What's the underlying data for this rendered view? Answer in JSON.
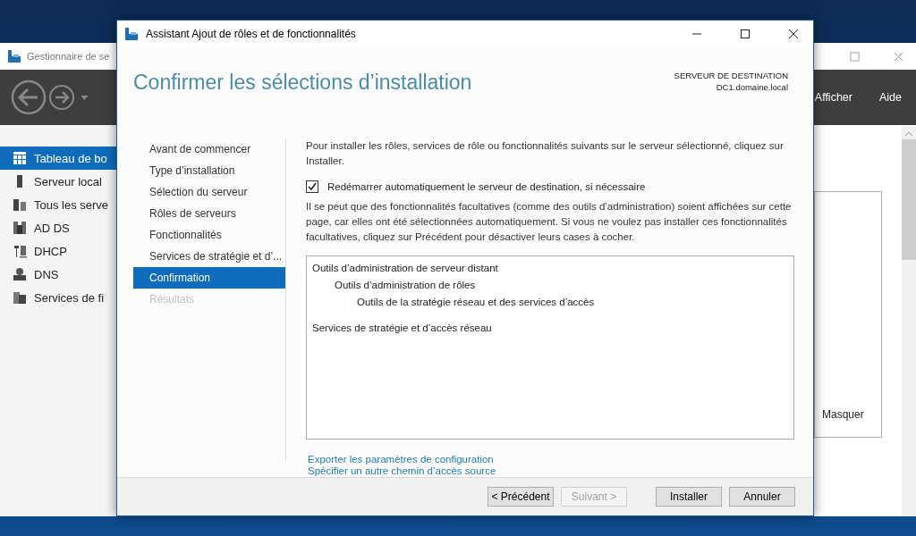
{
  "background_window": {
    "title": "Gestionnaire de se",
    "menu": [
      "Afficher",
      "Aide"
    ],
    "sidebar": [
      {
        "label": "Tableau de bo",
        "kind": "dashboard",
        "selected": true
      },
      {
        "label": "Serveur local",
        "kind": "server",
        "selected": false
      },
      {
        "label": "Tous les serve",
        "kind": "servers",
        "selected": false
      },
      {
        "label": "AD DS",
        "kind": "adds",
        "selected": false
      },
      {
        "label": "DHCP",
        "kind": "dhcp",
        "selected": false
      },
      {
        "label": "DNS",
        "kind": "dns",
        "selected": false
      },
      {
        "label": "Services de fi",
        "kind": "files",
        "selected": false
      }
    ],
    "panel_link": "Masquer"
  },
  "dialog": {
    "title": "Assistant Ajout de rôles et de fonctionnalités",
    "heading": "Confirmer les sélections d’installation",
    "destination_label": "SERVEUR DE DESTINATION",
    "destination_server": "DC1.domaine.local",
    "steps": [
      {
        "label": "Avant de commencer",
        "selected": false,
        "disabled": false
      },
      {
        "label": "Type d’installation",
        "selected": false,
        "disabled": false
      },
      {
        "label": "Sélection du serveur",
        "selected": false,
        "disabled": false
      },
      {
        "label": "Rôles de serveurs",
        "selected": false,
        "disabled": false
      },
      {
        "label": "Fonctionnalités",
        "selected": false,
        "disabled": false
      },
      {
        "label": "Services de stratégie et d’...",
        "selected": false,
        "disabled": false
      },
      {
        "label": "Confirmation",
        "selected": true,
        "disabled": false
      },
      {
        "label": "Résultats",
        "selected": false,
        "disabled": true
      }
    ],
    "intro": "Pour installer les rôles, services de rôle ou fonctionnalités suivants sur le serveur sélectionné, cliquez sur Installer.",
    "restart_option": {
      "label": "Redémarrer automatiquement le serveur de destination, si nécessaire",
      "checked": true
    },
    "note": "Il se peut que des fonctionnalités facultatives (comme des outils d’administration) soient affichées sur cette page, car elles ont été sélectionnées automatiquement. Si vous ne voulez pas installer ces fonctionnalités facultatives, cliquez sur Précédent pour désactiver leurs cases à cocher.",
    "selections": [
      {
        "label": "Outils d’administration de serveur distant",
        "children": [
          {
            "label": "Outils d’administration de rôles",
            "children": [
              {
                "label": "Outils de la stratégie réseau et des services d’accès"
              }
            ]
          }
        ]
      },
      {
        "label": "Services de stratégie et d’accès réseau"
      }
    ],
    "links": [
      "Exporter les paramètres de configuration",
      "Spécifier un autre chemin d’accès source"
    ],
    "buttons": [
      {
        "label": "< Précédent",
        "disabled": false
      },
      {
        "label": "Suivant >",
        "disabled": true
      },
      {
        "label": "Installer",
        "disabled": false
      },
      {
        "label": "Annuler",
        "disabled": false
      }
    ]
  }
}
